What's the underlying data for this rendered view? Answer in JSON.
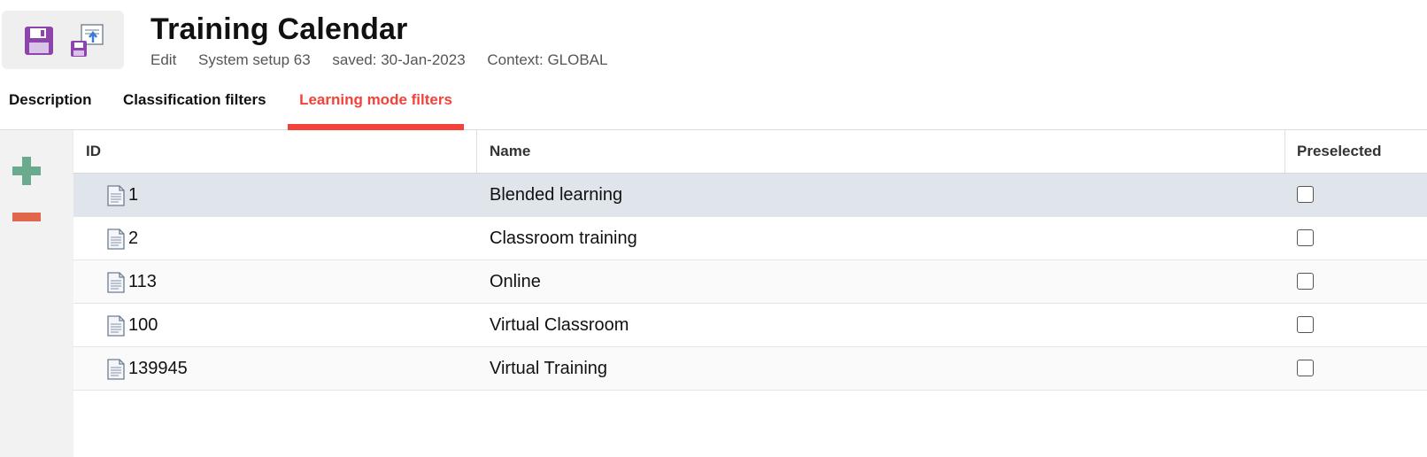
{
  "header": {
    "title": "Training Calendar",
    "meta": {
      "mode": "Edit",
      "system": "System setup 63",
      "saved": "saved: 30-Jan-2023",
      "context": "Context: GLOBAL"
    }
  },
  "toolbar": {
    "save_icon": "floppy-disk-icon",
    "save_as_icon": "save-as-icon"
  },
  "tabs": [
    {
      "label": "Description",
      "active": false
    },
    {
      "label": "Classification filters",
      "active": false
    },
    {
      "label": "Learning mode filters",
      "active": true
    }
  ],
  "side_actions": {
    "add_icon": "plus-icon",
    "remove_icon": "minus-icon",
    "add_color": "#6aaa8e",
    "remove_color": "#e0674a"
  },
  "grid": {
    "columns": [
      "ID",
      "Name",
      "Preselected"
    ],
    "rows": [
      {
        "id": "1",
        "name": "Blended learning",
        "preselected": false,
        "selected": true
      },
      {
        "id": "2",
        "name": "Classroom training",
        "preselected": false,
        "selected": false
      },
      {
        "id": "113",
        "name": "Online",
        "preselected": false,
        "selected": false
      },
      {
        "id": "100",
        "name": "Virtual Classroom",
        "preselected": false,
        "selected": false
      },
      {
        "id": "139945",
        "name": "Virtual Training",
        "preselected": false,
        "selected": false
      }
    ]
  },
  "colors": {
    "accent": "#f2423a",
    "selected_row": "#dfe5ea",
    "icon_purple": "#8e44ad"
  }
}
